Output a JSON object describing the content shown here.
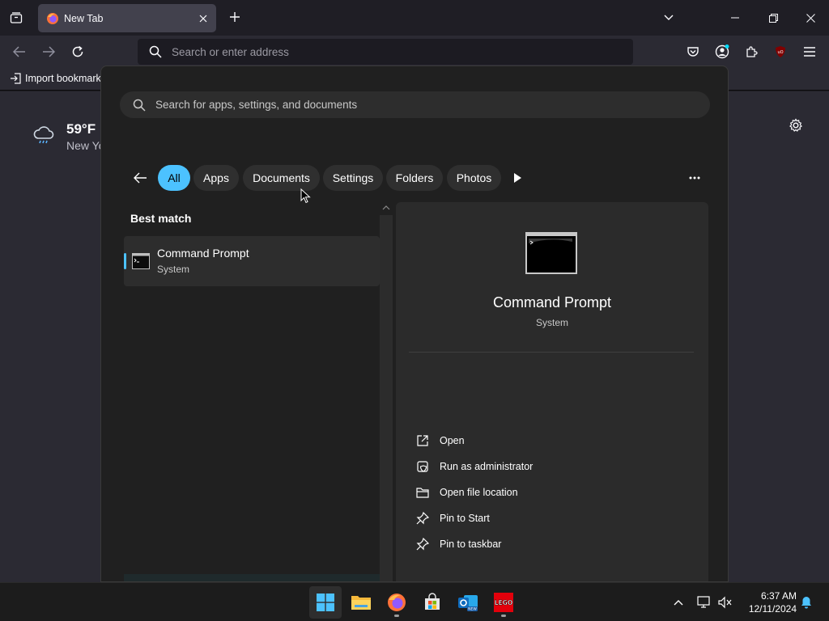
{
  "browser": {
    "tab_title": "New Tab",
    "address_placeholder": "Search or enter address",
    "bookmark_import": "Import bookmarks",
    "icons": [
      "tab-list-icon",
      "firefox-icon",
      "close-icon",
      "plus-icon",
      "chevron-down-icon",
      "minimize-icon",
      "restore-icon",
      "back-icon",
      "forward-icon",
      "reload-icon",
      "search-icon",
      "pocket-icon",
      "account-icon",
      "extensions-icon",
      "ublock-icon",
      "menu-icon",
      "gear-icon"
    ]
  },
  "weather": {
    "temp": "59°F",
    "city": "New York"
  },
  "start_search": {
    "placeholder": "Search for apps, settings, and documents",
    "filters": [
      "All",
      "Apps",
      "Documents",
      "Settings",
      "Folders",
      "Photos"
    ],
    "active_filter": "All",
    "best_match_label": "Best match",
    "result": {
      "name": "Command Prompt",
      "type": "System"
    },
    "detail": {
      "name": "Command Prompt",
      "type": "System",
      "actions": [
        "Open",
        "Run as administrator",
        "Open file location",
        "Pin to Start",
        "Pin to taskbar"
      ]
    }
  },
  "taskbar": {
    "apps": [
      "start-icon",
      "file-explorer-icon",
      "firefox-icon",
      "microsoft-store-icon",
      "outlook-new-icon",
      "lego-icon"
    ],
    "clock_time": "6:37 AM",
    "clock_date": "12/11/2024"
  },
  "colors": {
    "accent": "#4cc2ff",
    "flyout_bg": "#202020",
    "detail_bg": "#2b2b2b"
  }
}
